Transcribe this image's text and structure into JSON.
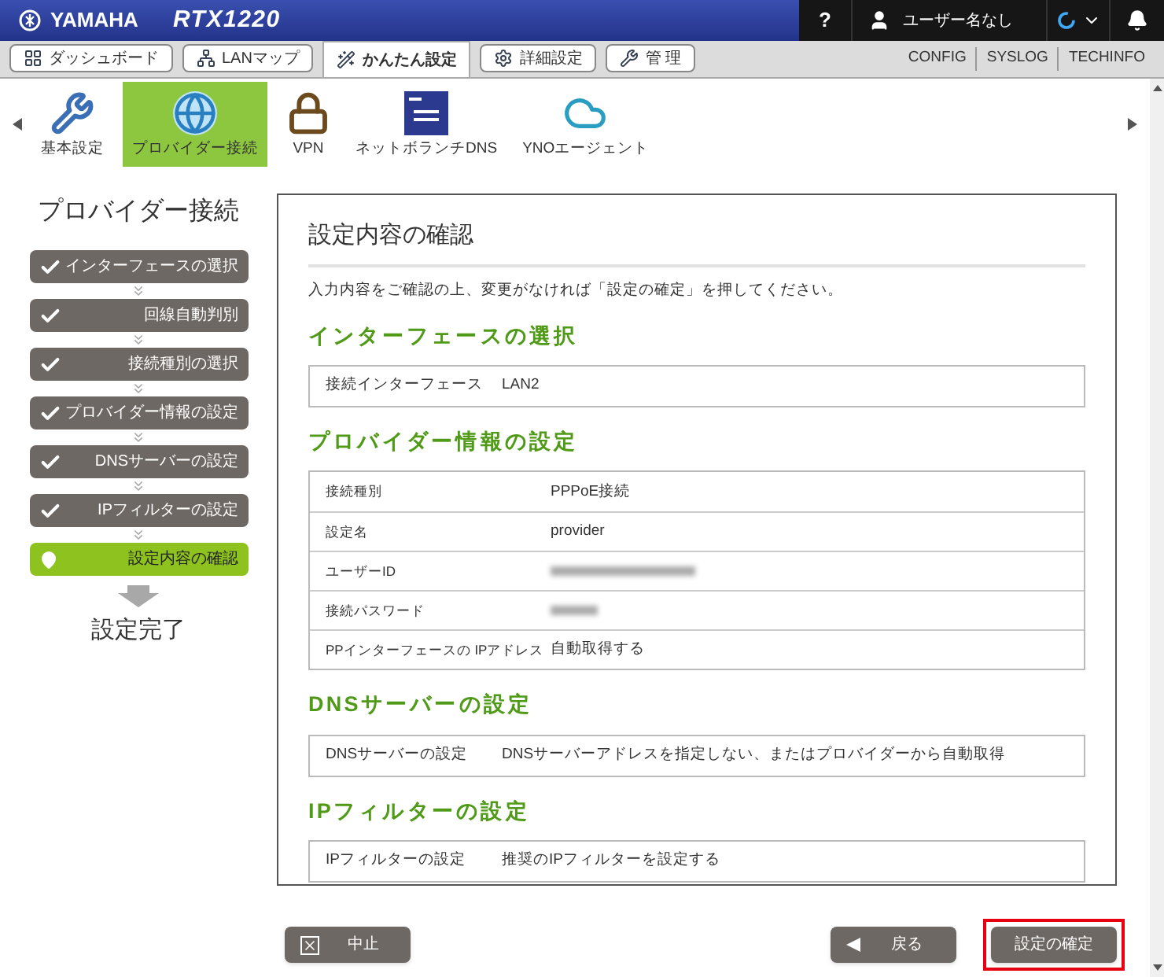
{
  "header": {
    "brand": "YAMAHA",
    "model": "RTX1220",
    "help": "?",
    "user": "ユーザー名なし"
  },
  "tabs": [
    {
      "label": "ダッシュボード",
      "selected": false
    },
    {
      "label": "LANマップ",
      "selected": false
    },
    {
      "label": "かんたん設定",
      "selected": true
    },
    {
      "label": "詳細設定",
      "selected": false
    },
    {
      "label": "管 理",
      "selected": false
    }
  ],
  "links": [
    "CONFIG",
    "SYSLOG",
    "TECHINFO"
  ],
  "wizards": [
    {
      "label": "基本設定",
      "selected": false
    },
    {
      "label": "プロバイダー接続",
      "selected": true
    },
    {
      "label": "VPN",
      "selected": false
    },
    {
      "label": "ネットボランチDNS",
      "selected": false
    },
    {
      "label": "YNOエージェント",
      "selected": false
    }
  ],
  "sidebar": {
    "title": "プロバイダー接続",
    "steps": [
      {
        "label": "インターフェースの選択",
        "selected": false
      },
      {
        "label": "回線自動判別",
        "selected": false
      },
      {
        "label": "接続種別の選択",
        "selected": false
      },
      {
        "label": "プロバイダー情報の設定",
        "selected": false
      },
      {
        "label": "DNSサーバーの設定",
        "selected": false
      },
      {
        "label": "IPフィルターの設定",
        "selected": false
      },
      {
        "label": "設定内容の確認",
        "selected": true
      }
    ],
    "final": "設定完了"
  },
  "panel": {
    "title": "設定内容の確認",
    "description": "入力内容をご確認の上、変更がなければ「設定の確定」を押してください。",
    "sections": [
      {
        "heading": "インターフェースの選択",
        "rows": [
          {
            "kind": "text",
            "label": "接続インターフェース",
            "value": "LAN2"
          }
        ]
      },
      {
        "heading": "プロバイダー情報の設定",
        "rows": [
          {
            "kind": "text",
            "label": "接続種別",
            "value": "PPPoE接続"
          },
          {
            "kind": "text",
            "label": "設定名",
            "value": "provider"
          },
          {
            "kind": "blurred",
            "label": "ユーザーID"
          },
          {
            "kind": "blurred",
            "label": "接続パスワード"
          },
          {
            "kind": "text",
            "label": "PPインターフェースの IPアドレス",
            "value": "自動取得する"
          }
        ]
      },
      {
        "heading": "DNSサーバーの設定",
        "rows": [
          {
            "kind": "text",
            "label": "DNSサーバーの設定",
            "value": "DNSサーバーアドレスを指定しない、またはプロバイダーから自動取得"
          }
        ]
      },
      {
        "heading": "IPフィルターの設定",
        "rows": [
          {
            "kind": "text",
            "label": "IPフィルターの設定",
            "value": "推奨のIPフィルターを設定する"
          }
        ]
      }
    ]
  },
  "buttons": [
    {
      "kind": "cancel",
      "label": "中止",
      "highlighted": false
    },
    {
      "kind": "back",
      "label": "戻る",
      "highlighted": false
    },
    {
      "kind": "confirm",
      "label": "設定の確定",
      "highlighted": true
    }
  ]
}
